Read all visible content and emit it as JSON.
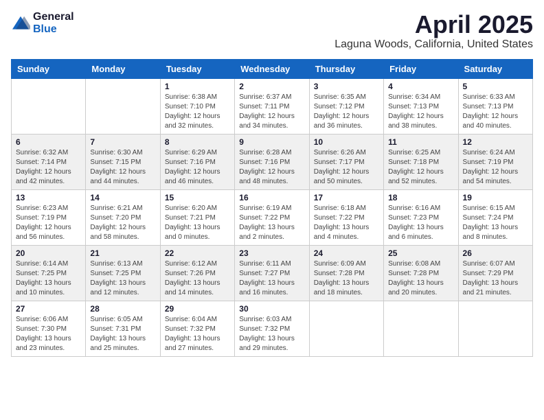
{
  "header": {
    "logo_general": "General",
    "logo_blue": "Blue",
    "month_year": "April 2025",
    "location": "Laguna Woods, California, United States"
  },
  "weekdays": [
    "Sunday",
    "Monday",
    "Tuesday",
    "Wednesday",
    "Thursday",
    "Friday",
    "Saturday"
  ],
  "weeks": [
    [
      {
        "day": "",
        "info": ""
      },
      {
        "day": "",
        "info": ""
      },
      {
        "day": "1",
        "info": "Sunrise: 6:38 AM\nSunset: 7:10 PM\nDaylight: 12 hours\nand 32 minutes."
      },
      {
        "day": "2",
        "info": "Sunrise: 6:37 AM\nSunset: 7:11 PM\nDaylight: 12 hours\nand 34 minutes."
      },
      {
        "day": "3",
        "info": "Sunrise: 6:35 AM\nSunset: 7:12 PM\nDaylight: 12 hours\nand 36 minutes."
      },
      {
        "day": "4",
        "info": "Sunrise: 6:34 AM\nSunset: 7:13 PM\nDaylight: 12 hours\nand 38 minutes."
      },
      {
        "day": "5",
        "info": "Sunrise: 6:33 AM\nSunset: 7:13 PM\nDaylight: 12 hours\nand 40 minutes."
      }
    ],
    [
      {
        "day": "6",
        "info": "Sunrise: 6:32 AM\nSunset: 7:14 PM\nDaylight: 12 hours\nand 42 minutes."
      },
      {
        "day": "7",
        "info": "Sunrise: 6:30 AM\nSunset: 7:15 PM\nDaylight: 12 hours\nand 44 minutes."
      },
      {
        "day": "8",
        "info": "Sunrise: 6:29 AM\nSunset: 7:16 PM\nDaylight: 12 hours\nand 46 minutes."
      },
      {
        "day": "9",
        "info": "Sunrise: 6:28 AM\nSunset: 7:16 PM\nDaylight: 12 hours\nand 48 minutes."
      },
      {
        "day": "10",
        "info": "Sunrise: 6:26 AM\nSunset: 7:17 PM\nDaylight: 12 hours\nand 50 minutes."
      },
      {
        "day": "11",
        "info": "Sunrise: 6:25 AM\nSunset: 7:18 PM\nDaylight: 12 hours\nand 52 minutes."
      },
      {
        "day": "12",
        "info": "Sunrise: 6:24 AM\nSunset: 7:19 PM\nDaylight: 12 hours\nand 54 minutes."
      }
    ],
    [
      {
        "day": "13",
        "info": "Sunrise: 6:23 AM\nSunset: 7:19 PM\nDaylight: 12 hours\nand 56 minutes."
      },
      {
        "day": "14",
        "info": "Sunrise: 6:21 AM\nSunset: 7:20 PM\nDaylight: 12 hours\nand 58 minutes."
      },
      {
        "day": "15",
        "info": "Sunrise: 6:20 AM\nSunset: 7:21 PM\nDaylight: 13 hours\nand 0 minutes."
      },
      {
        "day": "16",
        "info": "Sunrise: 6:19 AM\nSunset: 7:22 PM\nDaylight: 13 hours\nand 2 minutes."
      },
      {
        "day": "17",
        "info": "Sunrise: 6:18 AM\nSunset: 7:22 PM\nDaylight: 13 hours\nand 4 minutes."
      },
      {
        "day": "18",
        "info": "Sunrise: 6:16 AM\nSunset: 7:23 PM\nDaylight: 13 hours\nand 6 minutes."
      },
      {
        "day": "19",
        "info": "Sunrise: 6:15 AM\nSunset: 7:24 PM\nDaylight: 13 hours\nand 8 minutes."
      }
    ],
    [
      {
        "day": "20",
        "info": "Sunrise: 6:14 AM\nSunset: 7:25 PM\nDaylight: 13 hours\nand 10 minutes."
      },
      {
        "day": "21",
        "info": "Sunrise: 6:13 AM\nSunset: 7:25 PM\nDaylight: 13 hours\nand 12 minutes."
      },
      {
        "day": "22",
        "info": "Sunrise: 6:12 AM\nSunset: 7:26 PM\nDaylight: 13 hours\nand 14 minutes."
      },
      {
        "day": "23",
        "info": "Sunrise: 6:11 AM\nSunset: 7:27 PM\nDaylight: 13 hours\nand 16 minutes."
      },
      {
        "day": "24",
        "info": "Sunrise: 6:09 AM\nSunset: 7:28 PM\nDaylight: 13 hours\nand 18 minutes."
      },
      {
        "day": "25",
        "info": "Sunrise: 6:08 AM\nSunset: 7:28 PM\nDaylight: 13 hours\nand 20 minutes."
      },
      {
        "day": "26",
        "info": "Sunrise: 6:07 AM\nSunset: 7:29 PM\nDaylight: 13 hours\nand 21 minutes."
      }
    ],
    [
      {
        "day": "27",
        "info": "Sunrise: 6:06 AM\nSunset: 7:30 PM\nDaylight: 13 hours\nand 23 minutes."
      },
      {
        "day": "28",
        "info": "Sunrise: 6:05 AM\nSunset: 7:31 PM\nDaylight: 13 hours\nand 25 minutes."
      },
      {
        "day": "29",
        "info": "Sunrise: 6:04 AM\nSunset: 7:32 PM\nDaylight: 13 hours\nand 27 minutes."
      },
      {
        "day": "30",
        "info": "Sunrise: 6:03 AM\nSunset: 7:32 PM\nDaylight: 13 hours\nand 29 minutes."
      },
      {
        "day": "",
        "info": ""
      },
      {
        "day": "",
        "info": ""
      },
      {
        "day": "",
        "info": ""
      }
    ]
  ],
  "row_styles": [
    "white",
    "shaded",
    "white",
    "shaded",
    "white"
  ]
}
